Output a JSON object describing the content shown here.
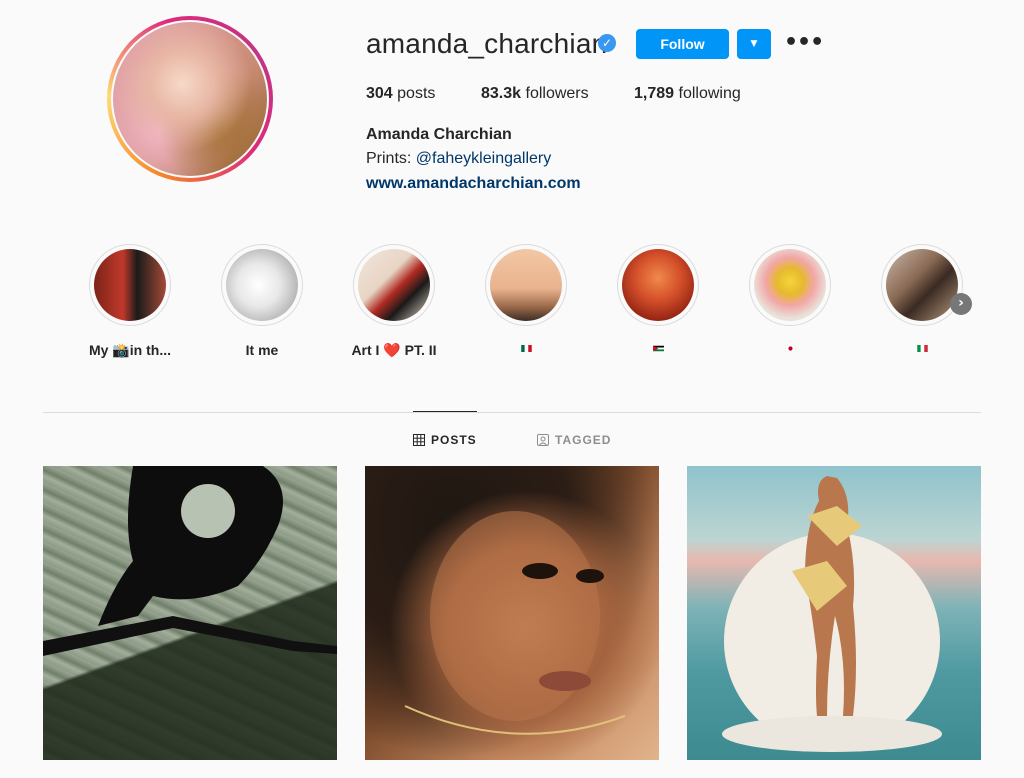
{
  "profile": {
    "username": "amanda_charchian",
    "verified_mark": "✓",
    "follow_label": "Follow",
    "dropdown_glyph": "▼",
    "more_glyph": "•••",
    "stats": {
      "posts_count": "304",
      "posts_label": " posts",
      "followers_count": "83.3k",
      "followers_label": " followers",
      "following_count": "1,789",
      "following_label": " following"
    },
    "full_name": "Amanda Charchian",
    "bio_prefix": "Prints: ",
    "bio_handle": "@faheykleingallery",
    "website": "www.amandacharchian.com"
  },
  "highlights": [
    {
      "label": "My 📸in th...",
      "icon": "photo-highlight"
    },
    {
      "label": "It me",
      "icon": "photo-highlight"
    },
    {
      "label": "Art I ❤️ PT. II",
      "icon": "photo-highlight"
    },
    {
      "label": "",
      "flag": "mexico-flag"
    },
    {
      "label": "",
      "flag": "jordan-flag"
    },
    {
      "label": "",
      "flag": "japan-flag"
    },
    {
      "label": "",
      "flag": "italy-flag"
    }
  ],
  "tabs": {
    "posts": "POSTS",
    "tagged": "TAGGED"
  },
  "icons": {
    "verified": "verified-badge-icon",
    "grid": "grid-icon",
    "tagged": "tagged-person-icon",
    "next": "chevron-right-icon"
  },
  "colors": {
    "accent": "#0095f6",
    "link": "#00376b",
    "muted": "#8e8e8e"
  }
}
